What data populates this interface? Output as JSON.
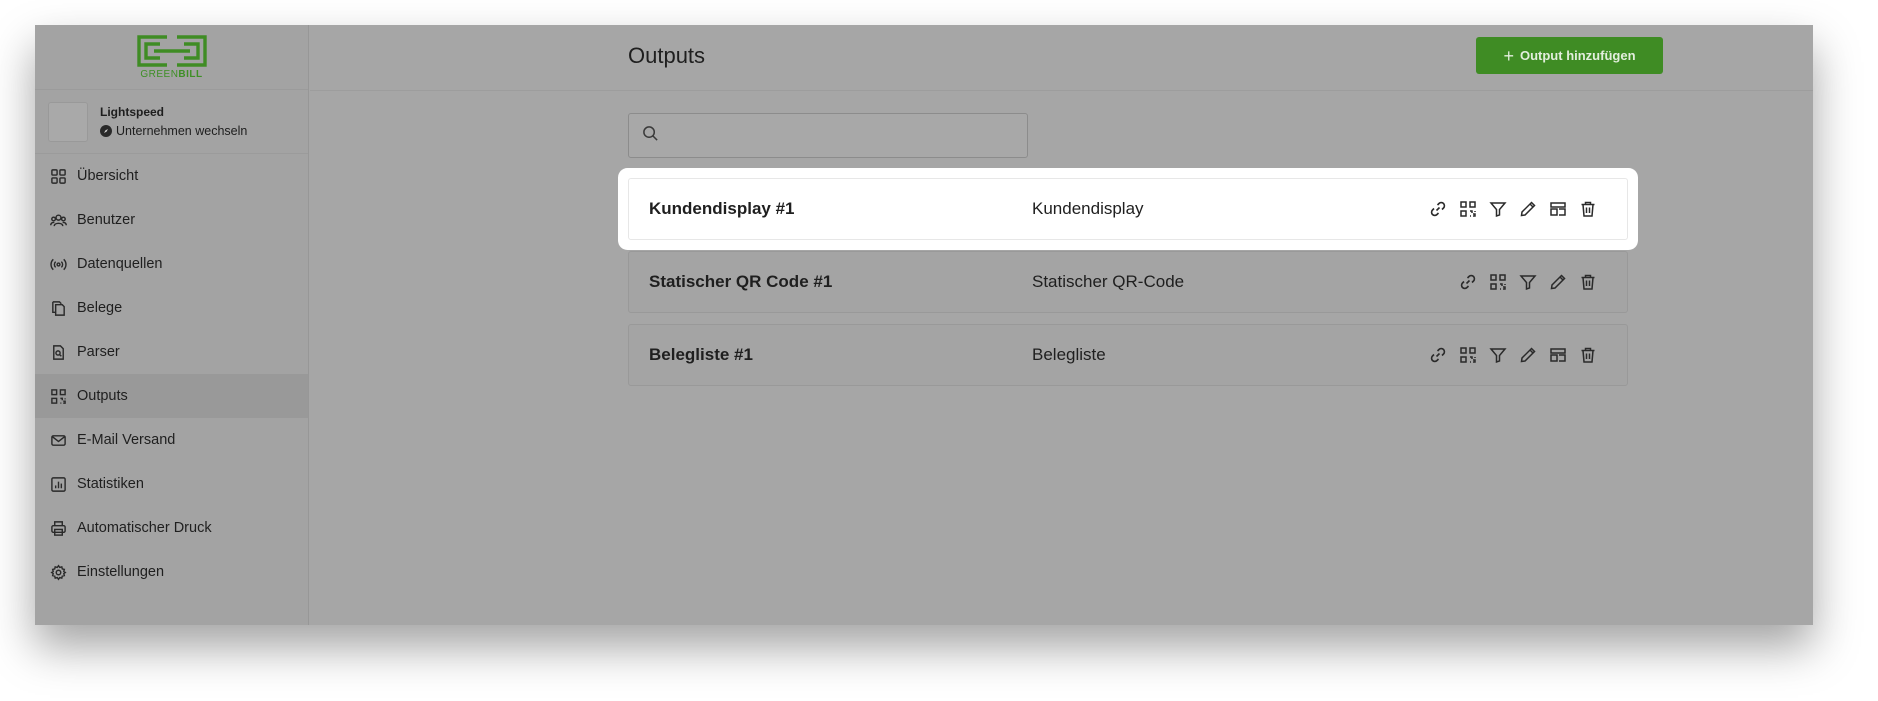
{
  "brand": {
    "logo_part1": "GREEN",
    "logo_part2": "BILL",
    "color": "#3f8c24"
  },
  "company": {
    "name": "Lightspeed",
    "switch_label": "Unternehmen wechseln"
  },
  "sidebar": {
    "items": [
      {
        "label": "Übersicht",
        "icon": "grid-icon",
        "active": false
      },
      {
        "label": "Benutzer",
        "icon": "users-icon",
        "active": false
      },
      {
        "label": "Datenquellen",
        "icon": "broadcast-icon",
        "active": false
      },
      {
        "label": "Belege",
        "icon": "documents-icon",
        "active": false
      },
      {
        "label": "Parser",
        "icon": "document-search-icon",
        "active": false
      },
      {
        "label": "Outputs",
        "icon": "qr-code-icon",
        "active": true
      },
      {
        "label": "E-Mail Versand",
        "icon": "mail-icon",
        "active": false
      },
      {
        "label": "Statistiken",
        "icon": "chart-icon",
        "active": false
      },
      {
        "label": "Automatischer Druck",
        "icon": "printer-icon",
        "active": false
      },
      {
        "label": "Einstellungen",
        "icon": "gear-icon",
        "active": false
      }
    ]
  },
  "header": {
    "title": "Outputs",
    "add_button_label": "Output hinzufügen"
  },
  "search": {
    "value": "",
    "placeholder": ""
  },
  "outputs": [
    {
      "name": "Kundendisplay #1",
      "type": "Kundendisplay",
      "highlighted": true,
      "actions": [
        "link-icon",
        "qr-code-icon",
        "filter-icon",
        "pencil-icon",
        "layout-icon",
        "trash-icon"
      ]
    },
    {
      "name": "Statischer QR Code #1",
      "type": "Statischer QR-Code",
      "highlighted": false,
      "actions": [
        "link-icon",
        "qr-code-icon",
        "filter-icon",
        "pencil-icon",
        "trash-icon"
      ]
    },
    {
      "name": "Belegliste #1",
      "type": "Belegliste",
      "highlighted": false,
      "actions": [
        "link-icon",
        "qr-code-icon",
        "filter-icon",
        "pencil-icon",
        "layout-icon",
        "trash-icon"
      ]
    }
  ]
}
